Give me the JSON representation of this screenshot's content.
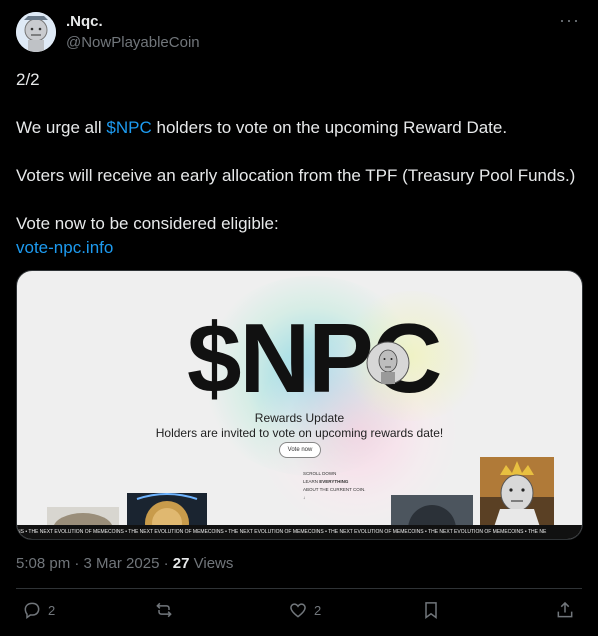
{
  "author": {
    "display_name": ".Nqc.",
    "handle": "@NowPlayableCoin"
  },
  "more_label": "···",
  "tweet": {
    "line1": "2/2",
    "line2_pre": "We urge all ",
    "line2_cashtag": "$NPC",
    "line2_post": " holders to vote on the upcoming Reward Date.",
    "line3": "Voters will receive an early allocation from the TPF (Treasury Pool Funds.)",
    "line4": "Vote now to be considered eligible:",
    "link": "vote-npc.info"
  },
  "media": {
    "logo_text": "$NPC",
    "rewards_title": "Rewards Update",
    "rewards_subtitle": "Holders are invited to vote on upcoming rewards date!",
    "vote_button": "Vote now",
    "scroll_line1": "SCROLL DOWN",
    "scroll_line2_pre": "LEARN ",
    "scroll_line2_bold": "EVERYTHING",
    "scroll_line3": "ABOUT THE CURRENT COIN.",
    "scroll_arrow": "↓",
    "ticker_text": "NS  •   THE NEXT EVOLUTION OF MEMECOINS  •   THE NEXT EVOLUTION OF MEMECOINS  •   THE NEXT EVOLUTION OF MEMECOINS  •   THE NEXT EVOLUTION OF MEMECOINS  •   THE NEXT EVOLUTION OF MEMECOINS  •   THE NE"
  },
  "meta": {
    "time": "5:08 pm",
    "separator": " · ",
    "date": "3 Mar 2025",
    "views_count": "27",
    "views_label": " Views"
  },
  "actions": {
    "reply_count": "2",
    "retweet_count": "",
    "like_count": "2"
  },
  "colors": {
    "accent": "#1d9bf0",
    "background": "#000000",
    "muted": "#71767b"
  }
}
